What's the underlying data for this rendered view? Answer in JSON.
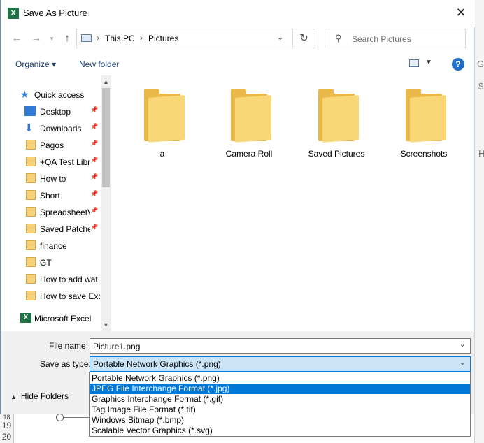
{
  "dialog": {
    "title": "Save As Picture",
    "close": "✕"
  },
  "address": {
    "crumbs": [
      "This PC",
      "Pictures"
    ],
    "separator": "›"
  },
  "search": {
    "placeholder": "Search Pictures"
  },
  "toolbar": {
    "organize": "Organize ▾",
    "new_folder": "New folder",
    "help": "?"
  },
  "nav": {
    "quick_access": "Quick access",
    "items": [
      {
        "label": "Desktop",
        "icon": "desktop-icon",
        "pinned": true
      },
      {
        "label": "Downloads",
        "icon": "download-arrow-icon",
        "pinned": true
      },
      {
        "label": "Pagos",
        "icon": "folder-icon",
        "pinned": true
      },
      {
        "label": "+QA Test Libr",
        "icon": "folder-icon",
        "pinned": true
      },
      {
        "label": "How to",
        "icon": "folder-icon",
        "pinned": true
      },
      {
        "label": "Short",
        "icon": "folder-icon",
        "pinned": true
      },
      {
        "label": "SpreadsheetV",
        "icon": "folder-icon",
        "pinned": true
      },
      {
        "label": "Saved Patche",
        "icon": "folder-icon",
        "pinned": true
      },
      {
        "label": "finance",
        "icon": "folder-icon",
        "pinned": false
      },
      {
        "label": "GT",
        "icon": "folder-icon",
        "pinned": false
      },
      {
        "label": "How to add wat",
        "icon": "folder-icon",
        "pinned": false
      },
      {
        "label": "How to save Exc",
        "icon": "folder-icon",
        "pinned": false
      }
    ],
    "excel": "Microsoft Excel"
  },
  "folders": [
    "a",
    "Camera Roll",
    "Saved Pictures",
    "Screenshots"
  ],
  "form": {
    "file_name_label": "File name:",
    "file_name_value": "Picture1.png",
    "save_as_type_label": "Save as type:",
    "save_as_type_value": "Portable Network Graphics (*.png)",
    "hide_folders": "Hide Folders"
  },
  "type_options": [
    "Portable Network Graphics (*.png)",
    "JPEG File Interchange Format (*.jpg)",
    "Graphics Interchange Format (*.gif)",
    "Tag Image File Format (*.tif)",
    "Windows Bitmap (*.bmp)",
    "Scalable Vector Graphics (*.svg)"
  ],
  "selected_type_index": 1,
  "excel_bg": {
    "row_numbers": [
      "18",
      "19",
      "20"
    ],
    "fragments": [
      "G",
      "$",
      "H"
    ]
  },
  "colors": {
    "accent": "#0078d7",
    "selection_fill": "#cce4f7",
    "folder": "#f9d776",
    "excel_green": "#1e7145"
  }
}
